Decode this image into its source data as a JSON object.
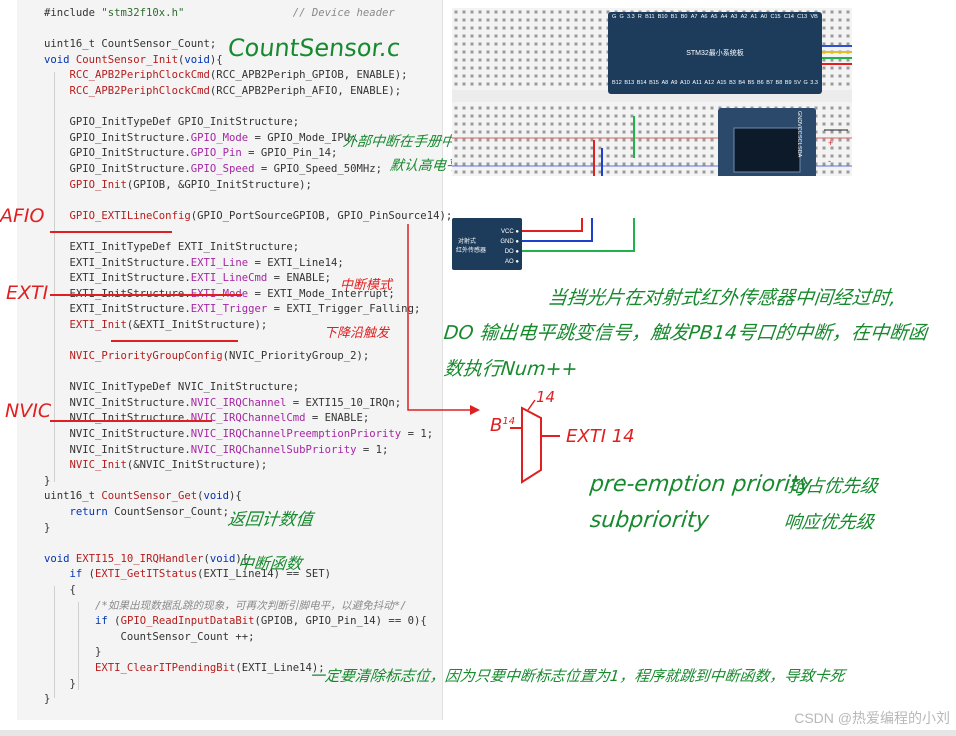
{
  "code_lines": [
    "#include \"stm32f10x.h\"                 // Device header",
    "",
    "uint16_t CountSensor_Count;",
    "void CountSensor_Init(void){",
    "    RCC_APB2PeriphClockCmd(RCC_APB2Periph_GPIOB, ENABLE);",
    "    RCC_APB2PeriphClockCmd(RCC_APB2Periph_AFIO, ENABLE);",
    "",
    "    GPIO_InitTypeDef GPIO_InitStructure;",
    "    GPIO_InitStructure.GPIO_Mode = GPIO_Mode_IPU;",
    "    GPIO_InitStructure.GPIO_Pin = GPIO_Pin_14;",
    "    GPIO_InitStructure.GPIO_Speed = GPIO_Speed_50MHz;",
    "    GPIO_Init(GPIOB, &GPIO_InitStructure);",
    "",
    "    GPIO_EXTILineConfig(GPIO_PortSourceGPIOB, GPIO_PinSource14);",
    "",
    "    EXTI_InitTypeDef EXTI_InitStructure;",
    "    EXTI_InitStructure.EXTI_Line = EXTI_Line14;",
    "    EXTI_InitStructure.EXTI_LineCmd = ENABLE;",
    "    EXTI_InitStructure.EXTI_Mode = EXTI_Mode_Interrupt;",
    "    EXTI_InitStructure.EXTI_Trigger = EXTI_Trigger_Falling;",
    "    EXTI_Init(&EXTI_InitStructure);",
    "",
    "    NVIC_PriorityGroupConfig(NVIC_PriorityGroup_2);",
    "",
    "    NVIC_InitTypeDef NVIC_InitStructure;",
    "    NVIC_InitStructure.NVIC_IRQChannel = EXTI15_10_IRQn;",
    "    NVIC_InitStructure.NVIC_IRQChannelCmd = ENABLE;",
    "    NVIC_InitStructure.NVIC_IRQChannelPreemptionPriority = 1;",
    "    NVIC_InitStructure.NVIC_IRQChannelSubPriority = 1;",
    "    NVIC_Init(&NVIC_InitStructure);",
    "}",
    "uint16_t CountSensor_Get(void){",
    "    return CountSensor_Count;",
    "}",
    "",
    "void EXTI15_10_IRQHandler(void){",
    "    if (EXTI_GetITStatus(EXTI_Line14) == SET)",
    "    {",
    "        /*如果出现数据乱跳的现象，可再次判断引脚电平，以避免抖动*/",
    "        if (GPIO_ReadInputDataBit(GPIOB, GPIO_Pin_14) == 0){",
    "            CountSensor_Count ++;",
    "        }",
    "        EXTI_ClearITPendingBit(EXTI_Line14);",
    "    }",
    "}"
  ],
  "annotations": {
    "file_title": "CountSensor.c",
    "ipu_note_1": "外部中断在手册中注明IPU",
    "ipu_note_2": "默认高电平",
    "afio_label": "AFIO",
    "exti_label": "EXTI",
    "interrupt_mode": "中断模式",
    "falling_edge": "下降沿触发",
    "nvic_label": "NVIC",
    "return_count": "返回计数值",
    "handler_note": "中断函数",
    "sensor_note_1": "当挡光片在对射式红外传感器中间经过时,",
    "sensor_note_2": "DO 输出电平跳变信号，触发PB14号口的中断，在中断函",
    "sensor_note_3": "数执行Num++",
    "mux_in": "B",
    "mux_in_sup": "14",
    "mux_top": "14",
    "mux_out": "EXTI 14",
    "preemption": "pre-emption priority",
    "preemption_cn": "抢占优先级",
    "subpriority": "subpriority",
    "subpriority_cn": "响应优先级",
    "clear_flag_note": "一定要清除标志位，因为只要中断标志位置为1，程序就跳到中断函数，导致卡死"
  },
  "breadboard": {
    "mcu_label": "STM32最小系统板",
    "mcu_top_pins": [
      "G",
      "G",
      "3.3",
      "R",
      "B11",
      "B10",
      "B1",
      "B0",
      "A7",
      "A6",
      "A5",
      "A4",
      "A3",
      "A2",
      "A1",
      "A0",
      "C15",
      "C14",
      "C13",
      "VB"
    ],
    "mcu_bottom_pins": [
      "B12",
      "B13",
      "B14",
      "B15",
      "A8",
      "A9",
      "A10",
      "A11",
      "A12",
      "A15",
      "B3",
      "B4",
      "B5",
      "B6",
      "B7",
      "B8",
      "B9",
      "5V",
      "G",
      "3.3"
    ],
    "sensor_label_1": "对射式",
    "sensor_label_2": "红外传感器",
    "sensor_pins": [
      "VCC",
      "GND",
      "DO",
      "AO"
    ],
    "oled_label": "OLED显示屏",
    "oled_pins": [
      "GND",
      "VCC",
      "SCL",
      "SDA"
    ],
    "rail_plus": "+",
    "rail_minus": "-"
  },
  "watermark": "CSDN @热爱编程的小刘",
  "colors": {
    "annotation_green": "#178a2e",
    "annotation_red": "#e02020",
    "wire_red": "#e02020",
    "wire_blue": "#1f3fcf",
    "wire_green": "#22b24c"
  }
}
